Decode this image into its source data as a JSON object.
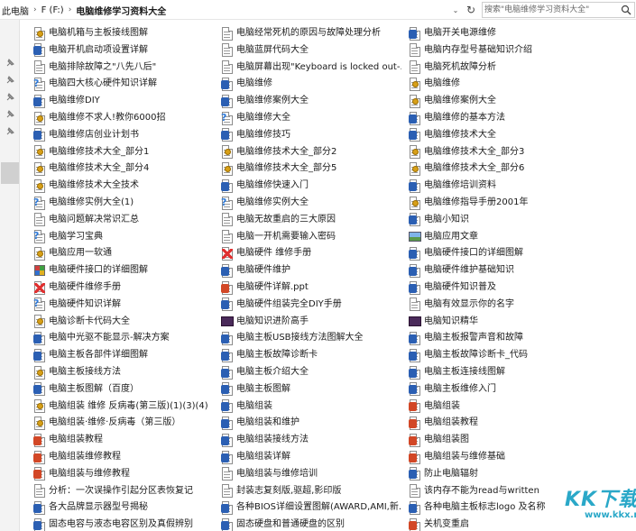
{
  "address": {
    "crumbs": [
      "此电脑",
      "F (F:)",
      "电脑维修学习资料大全"
    ],
    "dropdown_glyph": "⌄",
    "refresh_glyph": "↻",
    "separator_glyph": "›"
  },
  "search": {
    "placeholder": "搜索\"电脑维修学习资料大全\""
  },
  "watermark": {
    "text": "KK下载",
    "subtext": "www.kkx.net"
  },
  "files": [
    [
      "电脑机箱与主板接线图解",
      "电脑经常死机的原因与故障处理分析",
      "电脑开关电源维修"
    ],
    [
      "电脑开机启动项设置详解",
      "电脑蓝屏代码大全",
      "电脑内存型号基础知识介绍"
    ],
    [
      "电脑排除故障之\"八先八后\"",
      "电脑屏幕出现\"Keyboard is locked out-...",
      "电脑死机故障分析"
    ],
    [
      "电脑四大核心硬件知识详解",
      "电脑维修",
      "电脑维修"
    ],
    [
      "电脑维修DIY",
      "电脑维修案例大全",
      "电脑维修案例大全"
    ],
    [
      "电脑维修不求人!教你6000招",
      "电脑维修大全",
      "电脑维修的基本方法"
    ],
    [
      "电脑维修店创业计划书",
      "电脑维修技巧",
      "电脑维修技术大全"
    ],
    [
      "电脑维修技术大全_部分1",
      "电脑维修技术大全_部分2",
      "电脑维修技术大全_部分3"
    ],
    [
      "电脑维修技术大全_部分4",
      "电脑维修技术大全_部分5",
      "电脑维修技术大全_部分6"
    ],
    [
      "电脑维修技术大全技术",
      "电脑维修快速入门",
      "电脑维修培训资料"
    ],
    [
      "电脑维修实例大全(1)",
      "电脑维修实例大全",
      "电脑维修指导手册2001年"
    ],
    [
      "电脑问题解决常识汇总",
      "电脑无故重启的三大原因",
      "电脑小知识"
    ],
    [
      "电脑学习宝典",
      "电脑一开机需要输入密码",
      "电脑应用文章"
    ],
    [
      "电脑应用一软通",
      "电脑硬件 维修手册",
      "电脑硬件接口的详细图解"
    ],
    [
      "电脑硬件接口的详细图解",
      "电脑硬件维护",
      "电脑硬件维护基础知识"
    ],
    [
      "电脑硬件维修手册",
      "电脑硬件详解.ppt",
      "电脑硬件知识普及"
    ],
    [
      "电脑硬件知识详解",
      "电脑硬件组装完全DIY手册",
      "电脑有效显示你的名字"
    ],
    [
      "电脑诊断卡代码大全",
      "电脑知识进阶高手",
      "电脑知识精华"
    ],
    [
      "电脑中光驱不能显示-解决方案",
      "电脑主板USB接线方法图解大全",
      "电脑主板报警声音和故障"
    ],
    [
      "电脑主板各部件详细图解",
      "电脑主板故障诊断卡",
      "电脑主板故障诊断卡_代码"
    ],
    [
      "电脑主板接线方法",
      "电脑主板介绍大全",
      "电脑主板连接线图解"
    ],
    [
      "电脑主板图解（百度）",
      "电脑主板图解",
      "电脑主板维修入门"
    ],
    [
      "电脑组装 维修 反病毒(第三版)(1)(3)(4)",
      "电脑组装",
      "电脑组装"
    ],
    [
      "电脑组装·维修·反病毒（第三版）",
      "电脑组装和维护",
      "电脑组装教程"
    ],
    [
      "电脑组装教程",
      "电脑组装接线方法",
      "电脑组装图"
    ],
    [
      "电脑组装维修教程",
      "电脑组装详解",
      "电脑组装与维修基础"
    ],
    [
      "电脑组装与维修教程",
      "电脑组装与维修培训",
      "防止电脑辐射"
    ],
    [
      "分析：一次误操作引起分区表恢复记",
      "封装志复刻版,驱超,影印版",
      "该内存不能为read与written"
    ],
    [
      "各大品牌显示器型号揭秘",
      "各种BIOS详细设置图解(AWARD,AMI,新...",
      "各种电脑主板标志logo 及名称"
    ],
    [
      "固态电容与液态电容区别及真假辨别",
      "固态硬盘和普通硬盘的区别",
      "关机变重启"
    ]
  ],
  "icons": [
    [
      "lock-doc-icon",
      "text-doc-icon",
      "word-doc-icon"
    ],
    [
      "word-doc-icon",
      "text-doc-icon",
      "text-doc-icon"
    ],
    [
      "text-doc-icon",
      "text-doc-icon",
      "text-doc-icon"
    ],
    [
      "help-doc-icon",
      "word-doc-icon",
      "lock-doc-icon"
    ],
    [
      "word-doc-icon",
      "word-doc-icon",
      "lock-doc-icon"
    ],
    [
      "lock-doc-icon",
      "help-doc-icon",
      "word-doc-icon"
    ],
    [
      "word-doc-icon",
      "word-doc-icon",
      "word-doc-icon"
    ],
    [
      "lock-doc-icon",
      "lock-doc-icon",
      "lock-doc-icon"
    ],
    [
      "lock-doc-icon",
      "lock-doc-icon",
      "lock-doc-icon"
    ],
    [
      "lock-doc-icon",
      "word-doc-icon",
      "word-doc-icon"
    ],
    [
      "help-doc-icon",
      "help-doc-icon",
      "lock-doc-icon"
    ],
    [
      "text-doc-icon",
      "text-doc-icon",
      "word-doc-icon"
    ],
    [
      "help-doc-icon",
      "text-doc-icon",
      "picture-icon"
    ],
    [
      "lock-doc-icon",
      "cross-doc-icon",
      "word-doc-icon"
    ],
    [
      "colorful-grid-icon",
      "word-doc-icon",
      "word-doc-icon"
    ],
    [
      "cross-doc-icon",
      "ppt-doc-icon",
      "word-doc-icon"
    ],
    [
      "help-doc-icon",
      "word-doc-icon",
      "text-doc-icon"
    ],
    [
      "lock-doc-icon",
      "dark-image-icon",
      "dark-image-icon"
    ],
    [
      "word-doc-icon",
      "word-doc-icon",
      "word-doc-icon"
    ],
    [
      "word-doc-icon",
      "word-doc-icon",
      "word-doc-icon"
    ],
    [
      "lock-doc-icon",
      "word-doc-icon",
      "word-doc-icon"
    ],
    [
      "word-doc-icon",
      "word-doc-icon",
      "word-doc-icon"
    ],
    [
      "lock-doc-icon",
      "word-doc-icon",
      "ppt-doc-icon"
    ],
    [
      "lock-doc-icon",
      "word-doc-icon",
      "ppt-doc-icon"
    ],
    [
      "ppt-doc-icon",
      "word-doc-icon",
      "ppt-doc-icon"
    ],
    [
      "ppt-doc-icon",
      "word-doc-icon",
      "ppt-doc-icon"
    ],
    [
      "ppt-doc-icon",
      "text-doc-icon",
      "word-doc-icon"
    ],
    [
      "text-doc-icon",
      "text-doc-icon",
      "text-doc-icon"
    ],
    [
      "word-doc-icon",
      "word-doc-icon",
      "word-doc-icon"
    ],
    [
      "word-doc-icon",
      "word-doc-icon",
      "ppt-doc-icon"
    ]
  ],
  "colors": {
    "word": "#2b5fb3",
    "lock": "#d9a21b",
    "ppt": "#d24726",
    "help": "#2f7ad8",
    "accent": "#2aa8c8"
  }
}
